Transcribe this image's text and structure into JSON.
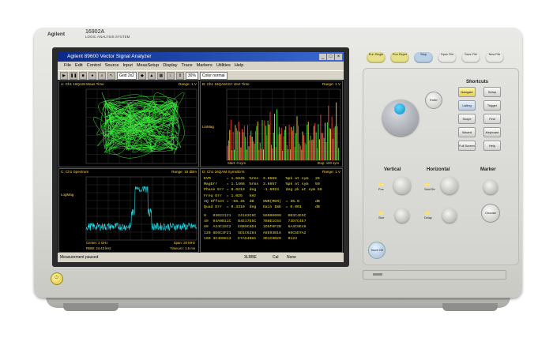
{
  "instrument": {
    "brand": "Agilent",
    "model": "16902A",
    "subtitle": "LOGIC ANALYSIS SYSTEM"
  },
  "window": {
    "title": "Agilent 89600 Vector Signal Analyzer",
    "controls": [
      "_",
      "□",
      "×"
    ]
  },
  "menu": [
    "File",
    "Edit",
    "Control",
    "Source",
    "Input",
    "MeasSetup",
    "Display",
    "Trace",
    "Markers",
    "Utilities",
    "Help"
  ],
  "toolbar": {
    "layout_select": "Grid 2x2",
    "buttons": [
      "play",
      "pause",
      "stop",
      "record"
    ]
  },
  "panes": {
    "a": {
      "header": "A: Ch1 16QAM Meas Time",
      "range": "Range: 1 V",
      "side": [
        "",
        ""
      ],
      "footer_left": "",
      "footer_right": ""
    },
    "b": {
      "header": "B: Ch1 16QAM Err Vect Time",
      "range": "Range: 1 V",
      "side_mid": "LinMag",
      "footer_left": "Start: 0 sym",
      "footer_right": "Stop: 100 sym"
    },
    "c": {
      "header": "C: Ch1 Spectrum",
      "range": "Range: 15 dBm",
      "side_mid": "LogMag",
      "footer_left": "Center: 2 GHz",
      "footer_right": "Span: 20 MHz",
      "footer2_left": "RBW: 24.43 kHz",
      "footer2_right": "TimeLen: 1.5 ms"
    },
    "d": {
      "header": "D: Ch1 16QAM Syms/Errs",
      "range": "Range: 1 V"
    }
  },
  "markers": {
    "x_marker": "30%",
    "readout": "Color normal"
  },
  "symbol_table": {
    "rows": [
      [
        "EVM",
        "= 1.5845",
        "%rms",
        "3.8568",
        "%pk at sym",
        "26"
      ],
      [
        "MagErr",
        "= 1.1466",
        "%rms",
        "3.6657",
        "%pk at sym",
        "59"
      ],
      [
        "Phase Err",
        "= 0.6213",
        "deg",
        "-1.6923",
        "deg pk at sym",
        "59"
      ],
      [
        "Freq Err",
        "= 1.025",
        "kHz",
        "",
        "",
        ""
      ],
      [
        "IQ Offset",
        "= -56.45",
        "dB",
        "SNR(MER)",
        "= 36.0",
        "dB"
      ],
      [
        "Quad Err",
        "= 0.3310",
        "deg",
        "Gain Imb",
        "= 0.001",
        "dB"
      ]
    ],
    "hex": [
      "0   03022121   24183C6C   58000000   0B3C4E5C",
      "40  04A0B11C   B4E17E5C   7B8E1C64   73D7C4E7",
      "80  A34C15C2   E6B0C8D4   1D5F0F2B   6A3C9E48",
      "120 8E6C3F21   5D1C6284   A8E03B16   90C5D7A2",
      "160 3C4D0813   E7A54B61   3D1C8B20   0123"
    ]
  },
  "status": {
    "message": "Measurement paused",
    "mid": "3LRBE",
    "cal": "Cal",
    "none": "None"
  },
  "front_panel": {
    "top_keys": [
      "Run Single",
      "Run Repet",
      "Stop",
      "Open File",
      "Save File",
      "New File"
    ],
    "top_key_colors": [
      "#e6e08a",
      "#e6e08a",
      "#b9d0e6",
      "#e9e9e6",
      "#e9e9e6",
      "#e9e9e6"
    ],
    "enter": "Enter",
    "shortcuts_title": "Shortcuts",
    "shortcuts": [
      "Navigate",
      "Setup",
      "Listing",
      "Trigger",
      "Scope",
      "Find",
      "Waved",
      "Keyboard",
      "Full Screen",
      "Help"
    ],
    "vertical": "Vertical",
    "horizontal": "Horizontal",
    "marker": "Marker",
    "vertical_labels": [
      "Pos",
      "Size"
    ],
    "horizontal_labels": [
      "Size/Div",
      "Delay"
    ],
    "choose": "Choose",
    "touch": "Touch Off"
  },
  "colors": {
    "trace_green": "#3ce83c",
    "trace_cyan": "#22d8e8",
    "table_yellow": "#f0e040",
    "titlebar": "#0a2a8a"
  }
}
